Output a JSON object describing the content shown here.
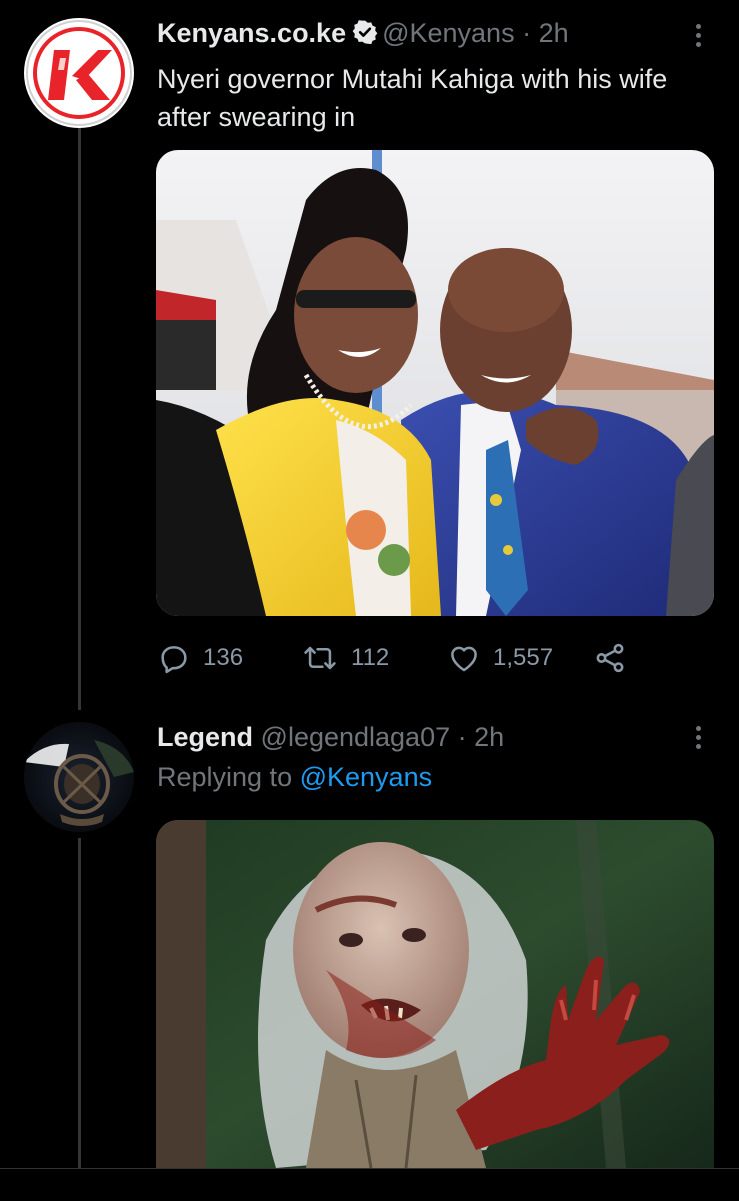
{
  "tweet1": {
    "display_name": "Kenyans.co.ke",
    "handle": "@Kenyans",
    "separator": "·",
    "time": "2h",
    "text": "Nyeri governor Mutahi Kahiga with his wife after swearing in",
    "avatar_icon": "kenyans-k-logo-icon",
    "replies": "136",
    "retweets": "112",
    "likes": "1,557"
  },
  "tweet2": {
    "display_name": "Legend",
    "handle": "@legendlaga07",
    "separator": "·",
    "time": "2h",
    "replying_prefix": "Replying to",
    "replying_mention": "@Kenyans",
    "avatar_icon": "police-emblem-icon"
  },
  "colors": {
    "background": "#000000",
    "text_primary": "#e7e9ea",
    "text_secondary": "#71767b",
    "accent": "#1d9bf0",
    "verified": "#e7e9ea",
    "thread_line": "#333639",
    "kenyans_red": "#e8242a"
  }
}
